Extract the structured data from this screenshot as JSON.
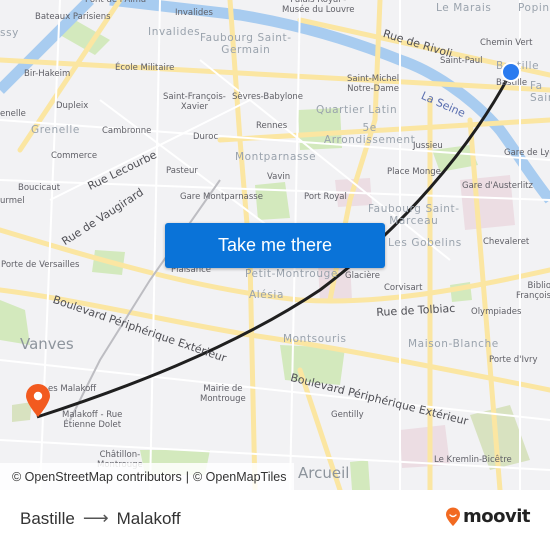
{
  "map": {
    "labels": {
      "pont_alma": "Pont de l'Alma",
      "bateaux": "Bateaux Parisiens",
      "passy": "ssy",
      "bir_hakeim": "Bir-Hakeim",
      "ecole_militaire": "École Militaire",
      "invalides_station": "Invalides",
      "invalides_district": "Invalides",
      "faubourg_st_germain": "Faubourg Saint-\nGermain",
      "palais_royal": "Palais Royal -\nMusée du Louvre",
      "rue_rivoli": "Rue de Rivoli",
      "le_marais": "Le Marais",
      "popincourt": "Popin",
      "chemin_vert": "Chemin Vert",
      "saint_paul": "Saint-Paul",
      "bastille_district": "Bastille",
      "bastille_station": "Bastille",
      "saint_antoine": "Fa\nSain",
      "saint_michel": "Saint-Michel\nNotre-Dame",
      "la_seine": "La Seine",
      "quartier_latin": "Quartier Latin",
      "cinquieme": "5e\nArrondissement",
      "jussieu": "Jussieu",
      "gare_de_lyon": "Gare de Lyo",
      "dupleix": "Dupleix",
      "st_francois_xavier": "Saint-François-\nXavier",
      "sevres_babylone": "Sèvres-Babylone",
      "grenelle_station": "enelle",
      "grenelle": "Grenelle",
      "cambronne": "Cambronne",
      "rennes": "Rennes",
      "duroc": "Duroc",
      "montparnasse": "Montparnasse",
      "commerce": "Commerce",
      "rue_lecourbe": "Rue Lecourbe",
      "pasteur": "Pasteur",
      "vavin": "Vavin",
      "place_monge": "Place Monge",
      "gare_austerlitz": "Gare d'Austerlitz",
      "boucicaut": "Boucicaut",
      "rue_vaugirard": "Rue de Vaugirard",
      "gare_montparnasse": "Gare Montparnasse",
      "port_royal": "Port Royal",
      "faubourg_st_marceau": "Faubourg Saint-\nMarceau",
      "lourmel": "urmel",
      "les_gobelins": "Les Gobelins",
      "chevaleret": "Chevaleret",
      "porte_versailles": "Porte de Versailles",
      "plaisance": "Plaisance",
      "petit_montrouge": "Petit-Montrouge",
      "glaciere": "Glacière",
      "corvisart": "Corvisart",
      "bibliotheque": "Biblio\nFrançois",
      "alesia": "Alésia",
      "bd_peripherique_w": "Boulevard Périphérique Extérieur",
      "rue_tolbiac": "Rue de Tolbiac",
      "olympiades": "Olympiades",
      "vanves": "Vanves",
      "montsouris": "Montsouris",
      "maison_blanche": "Maison-Blanche",
      "porte_ivry": "Porte d'Ivry",
      "plateau_malakoff": "es Malakoff",
      "mairie_montrouge": "Mairie de\nMontrouge",
      "bd_peripherique_e": "Boulevard Périphérique Extérieur",
      "malakoff_etienne_dolet": "Malakoff - Rue\nÉtienne Dolet",
      "gentilly": "Gentilly",
      "chatillon": "Châtillon-\nMontrouge",
      "arcueil": "Arcueil",
      "kremlin_bicetre": "Le Kremlin-Bicêtre"
    },
    "route": {
      "origin": "Bastille",
      "destination": "Malakoff"
    },
    "colors": {
      "route_line": "#1f1f1f",
      "origin_marker": "#2a7bef",
      "destination_marker": "#f25a1f",
      "water": "#a8ccf0",
      "major_road": "#fbe6a2",
      "park": "#cfe8b5",
      "background": "#f2f2f4"
    }
  },
  "cta": {
    "label": "Take me there",
    "color": "#0a73d8"
  },
  "attribution": {
    "osm": "© OpenStreetMap contributors",
    "separator": "|",
    "omt": "© OpenMapTiles"
  },
  "footer": {
    "origin": "Bastille",
    "arrow": "⟶",
    "destination": "Malakoff",
    "logo_text": "moovit",
    "logo_color": "#f26a21"
  }
}
